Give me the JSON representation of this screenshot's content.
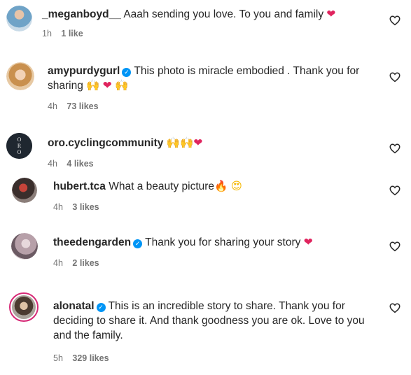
{
  "comments": [
    {
      "username": "_meganboyd__",
      "verified": false,
      "text": "Aaah sending you love. To you and family",
      "time": "1h",
      "likes": "1 like"
    },
    {
      "username": "amypurdygurl",
      "verified": true,
      "text": "This photo is miracle embodied . Thank you for sharing",
      "time": "4h",
      "likes": "73 likes"
    },
    {
      "username": "oro.cyclingcommunity",
      "verified": false,
      "text": "",
      "time": "4h",
      "likes": "4 likes"
    },
    {
      "username": "hubert.tca",
      "verified": false,
      "text": "What a beauty picture",
      "time": "4h",
      "likes": "3 likes"
    },
    {
      "username": "theedengarden",
      "verified": true,
      "text": "Thank you for sharing your story",
      "time": "4h",
      "likes": "2 likes"
    },
    {
      "username": "alonatal",
      "verified": true,
      "text": "This is an incredible story to share. Thank you for deciding to share it. And thank goodness you are ok. Love to you and the family.",
      "time": "5h",
      "likes": "329 likes"
    }
  ],
  "icons": {
    "like": "heart-outline-icon",
    "verified": "verified-badge-icon"
  },
  "colors": {
    "verified_blue": "#0095f6",
    "heart_red": "#e0245e",
    "meta_gray": "#737373",
    "story_ring": "#d62976"
  }
}
